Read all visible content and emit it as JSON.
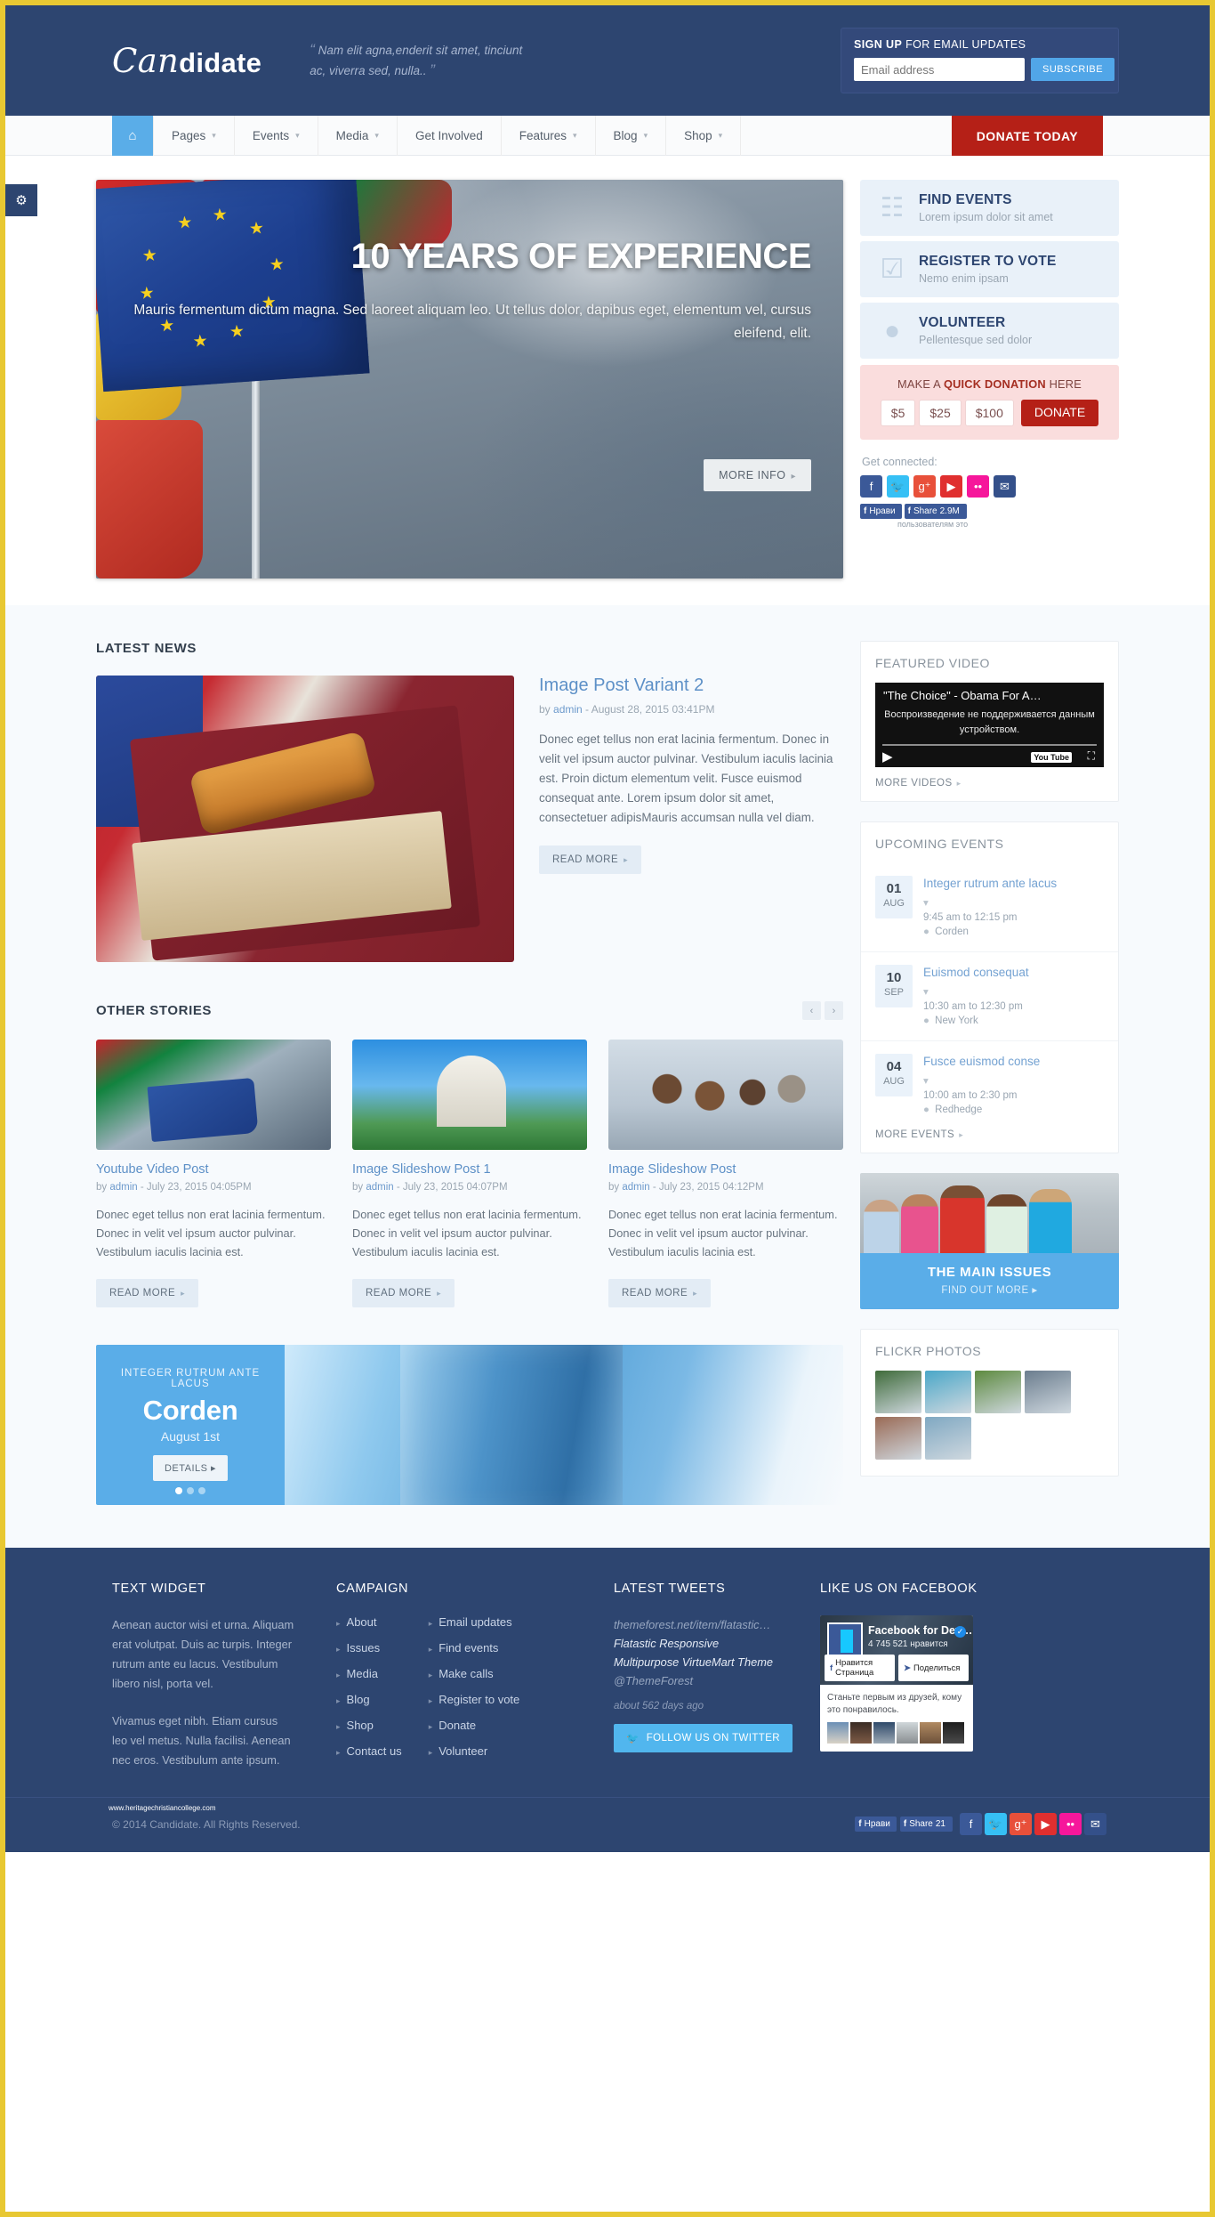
{
  "brand": {
    "script": "Can",
    "bold": "didate"
  },
  "tagline": {
    "open": "“",
    "text": "Nam elit agna,enderit sit amet, tinciunt ac, viverra sed, nulla..",
    "close": "”"
  },
  "signup": {
    "bold": "SIGN UP",
    "rest": " FOR EMAIL UPDATES",
    "placeholder": "Email address",
    "value": "",
    "button": "SUBSCRIBE"
  },
  "nav": {
    "home_icon": "home-icon",
    "items": [
      {
        "label": "Pages",
        "caret": "▾"
      },
      {
        "label": "Events",
        "caret": "▾"
      },
      {
        "label": "Media",
        "caret": "▾"
      },
      {
        "label": "Get Involved",
        "caret": ""
      },
      {
        "label": "Features",
        "caret": "▾"
      },
      {
        "label": "Blog",
        "caret": "▾"
      },
      {
        "label": "Shop",
        "caret": "▾"
      }
    ],
    "donate": "DONATE TODAY"
  },
  "settings_icon": "⚙",
  "hero": {
    "title": "10 YEARS OF EXPERIENCE",
    "subtitle": "Mauris fermentum dictum magna. Sed laoreet aliquam leo. Ut tellus dolor, dapibus eget, elementum vel, cursus eleifend, elit.",
    "button": "MORE INFO",
    "arrow": "▸"
  },
  "side_actions": [
    {
      "icon": "calendar-icon",
      "glyph": "☷",
      "title": "FIND EVENTS",
      "sub": "Lorem ipsum dolor sit amet"
    },
    {
      "icon": "checkbox-icon",
      "glyph": "☑",
      "title": "REGISTER TO VOTE",
      "sub": "Nemo enim ipsam"
    },
    {
      "icon": "user-icon",
      "glyph": "●",
      "title": "VOLUNTEER",
      "sub": "Pellentesque sed dolor"
    }
  ],
  "donation": {
    "pre": "MAKE A ",
    "bold": "QUICK DONATION",
    "post": " HERE",
    "amounts": [
      "$5",
      "$25",
      "$100"
    ],
    "button": "DONATE"
  },
  "get_connected": {
    "label": "Get connected:",
    "socials": [
      {
        "name": "facebook-icon",
        "glyph": "f",
        "color": "#3b5998"
      },
      {
        "name": "twitter-icon",
        "glyph": "🐦",
        "color": "#36c0f5"
      },
      {
        "name": "googleplus-icon",
        "glyph": "g⁺",
        "color": "#e8503a"
      },
      {
        "name": "youtube-icon",
        "glyph": "▶",
        "color": "#e02f2f"
      },
      {
        "name": "flickr-icon",
        "glyph": "••",
        "color": "#f6179b"
      },
      {
        "name": "email-icon",
        "glyph": "✉",
        "color": "#34508a"
      }
    ],
    "fb_like": "Нрави",
    "fb_share": "Share",
    "fb_count": "2.9M",
    "fb_sub": "пользователям это"
  },
  "latest_news": {
    "heading": "LATEST NEWS",
    "post": {
      "title": "Image Post Variant 2",
      "meta_by": "by ",
      "meta_author": "admin",
      "meta_rest": " - August 28, 2015 03:41PM",
      "text": "Donec eget tellus non erat lacinia fermentum. Donec in velit vel ipsum auctor pulvinar. Vestibulum iaculis lacinia est. Proin dictum elementum velit. Fusce euismod consequat ante. Lorem ipsum dolor sit amet, consectetuer adipisMauris accumsan nulla vel diam.",
      "button": "READ MORE"
    }
  },
  "other_stories": {
    "heading": "OTHER STORIES",
    "prev": "‹",
    "next": "›",
    "items": [
      {
        "title": "Youtube Video Post",
        "meta_by": "by ",
        "meta_author": "admin",
        "meta_rest": " - July 23, 2015 04:05PM",
        "text": "Donec eget tellus non erat lacinia fermentum. Donec in velit vel ipsum auctor pulvinar. Vestibulum iaculis lacinia est.",
        "button": "READ MORE"
      },
      {
        "title": "Image Slideshow Post 1",
        "meta_by": "by ",
        "meta_author": "admin",
        "meta_rest": " - July 23, 2015 04:07PM",
        "text": "Donec eget tellus non erat lacinia fermentum. Donec in velit vel ipsum auctor pulvinar. Vestibulum iaculis lacinia est.",
        "button": "READ MORE"
      },
      {
        "title": "Image Slideshow Post",
        "meta_by": "by ",
        "meta_author": "admin",
        "meta_rest": " - July 23, 2015 04:12PM",
        "text": "Donec eget tellus non erat lacinia fermentum. Donec in velit vel ipsum auctor pulvinar. Vestibulum iaculis lacinia est.",
        "button": "READ MORE"
      }
    ]
  },
  "corden": {
    "kicker": "INTEGER RUTRUM ANTE LACUS",
    "name": "Corden",
    "date": "August 1st",
    "button": "DETAILS",
    "arrow": "▸"
  },
  "featured_video": {
    "heading": "FEATURED VIDEO",
    "video_title": "\"The Choice\" - Obama For A…",
    "message": "Воспроизведение не поддерживается данным устройством.",
    "play_icon": "▶",
    "yt_logo": "You Tube",
    "fullscreen_icon": "⛶",
    "more": "MORE VIDEOS"
  },
  "upcoming_events": {
    "heading": "UPCOMING EVENTS",
    "items": [
      {
        "day": "01",
        "month": "AUG",
        "title": "Integer rutrum ante lacus",
        "time": "9:45 am to 12:15 pm",
        "place": "Corden"
      },
      {
        "day": "10",
        "month": "SEP",
        "title": "Euismod consequat",
        "time": "10:30 am to 12:30 pm",
        "place": "New York"
      },
      {
        "day": "04",
        "month": "AUG",
        "title": "Fusce euismod conse",
        "time": "10:00 am to 2:30 pm",
        "place": "Redhedge"
      }
    ],
    "more": "MORE EVENTS"
  },
  "main_issues": {
    "title": "THE MAIN ISSUES",
    "link": "FIND OUT MORE",
    "arrow": "▸"
  },
  "flickr": {
    "heading": "FLICKR PHOTOS",
    "photos": [
      "#3f6b3a",
      "#4aa7c8",
      "#5d8a3f",
      "#6b7d8e",
      "#9a6a55",
      "#7fa8c2"
    ]
  },
  "footer": {
    "text_widget": {
      "title": "TEXT WIDGET",
      "p1": "Aenean auctor wisi et urna. Aliquam erat volutpat. Duis ac turpis. Integer rutrum ante eu lacus. Vestibulum libero nisl, porta vel.",
      "p2": "Vivamus eget nibh. Etiam cursus leo vel metus. Nulla facilisi. Aenean nec eros. Vestibulum ante ipsum."
    },
    "campaign": {
      "title": "CAMPAIGN",
      "col1": [
        "About",
        "Issues",
        "Media",
        "Blog",
        "Shop",
        "Contact us"
      ],
      "col2": [
        "Email updates",
        "Find events",
        "Make calls",
        "Register to vote",
        "Donate",
        "Volunteer"
      ]
    },
    "tweets": {
      "title": "LATEST TWEETS",
      "link": "themeforest.net/item/flatastic…",
      "body": "Flatastic Responsive Multipurpose VirtueMart Theme ",
      "handle": "@ThemeForest",
      "ago": "about 562 days ago",
      "button": "FOLLOW US ON TWITTER"
    },
    "facebook": {
      "title": "LIKE US ON FACEBOOK",
      "page_name": "Facebook for Dev…",
      "likes": "4 745 521 нравится",
      "like_btn": "Нравится Страница",
      "share_btn": "Поделиться",
      "note": "Станьте первым из друзей, кому это понравилось."
    }
  },
  "bottom": {
    "watermark": "www.heritagechristiancollege.com",
    "copyright": "© 2014 Candidate. All Rights Reserved.",
    "fb_like": "Нрави",
    "fb_share": "Share",
    "fb_count": "21"
  }
}
